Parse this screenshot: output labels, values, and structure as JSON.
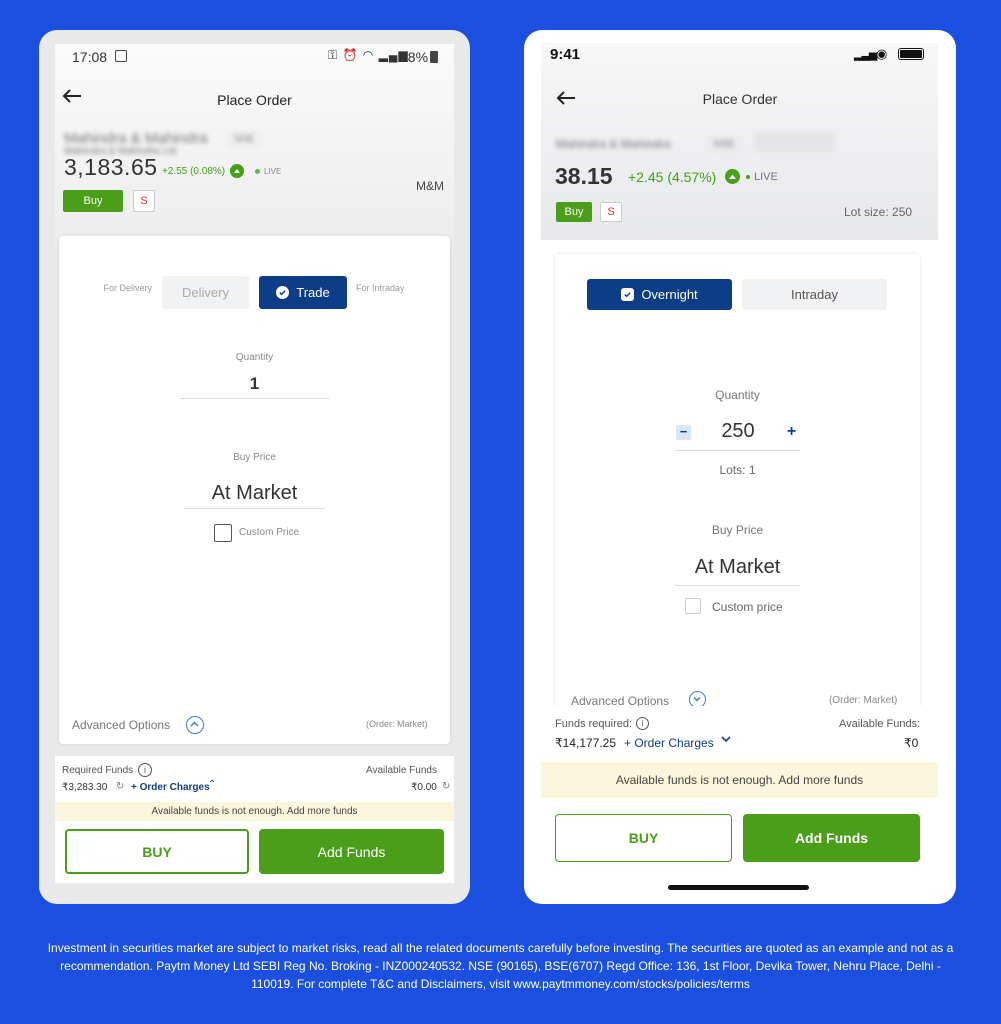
{
  "left": {
    "status_time": "17:08",
    "status_battery": "68%",
    "header_title": "Place Order",
    "stock_name": "Mahindra & Mahindra",
    "stock_subname": "Mahindra & Mahindra Ltd",
    "exchange": "NSE",
    "price": "3,183.65",
    "change": "+2.55 (0.08%)",
    "live_label": "LIVE",
    "symbol": "M&M",
    "buy_small": "Buy",
    "sell_small": "S",
    "delivery_caption": "For Delivery",
    "delivery_label": "Delivery",
    "trade_label": "Trade",
    "intraday_caption": "For Intraday",
    "quantity_label": "Quantity",
    "quantity_value": "1",
    "buy_price_label": "Buy Price",
    "buy_price_value": "At Market",
    "custom_price_label": "Custom Price",
    "advanced_label": "Advanced Options",
    "order_type": "(Order: Market)",
    "required_funds_label": "Required Funds",
    "required_funds_value": "₹3,283.30",
    "order_charges": "+ Order Charges",
    "available_funds_label": "Available Funds",
    "available_funds_value": "₹0.00",
    "warning": "Available funds is not enough. Add more funds",
    "buy_button": "BUY",
    "add_funds_button": "Add Funds"
  },
  "right": {
    "status_time": "9:41",
    "header_title": "Place Order",
    "stock_name": "Mahindra & Mahindra",
    "exchange": "NSE",
    "price": "38.15",
    "change": "+2.45 (4.57%)",
    "live_label": "LIVE",
    "lot_size": "Lot size: 250",
    "buy_small": "Buy",
    "sell_small": "S",
    "overnight_label": "Overnight",
    "intraday_label": "Intraday",
    "quantity_label": "Quantity",
    "quantity_value": "250",
    "minus": "−",
    "plus": "+",
    "lots": "Lots: 1",
    "buy_price_label": "Buy Price",
    "buy_price_value": "At Market",
    "custom_price_label": "Custom price",
    "advanced_label": "Advanced Options",
    "order_type": "(Order: Market)",
    "funds_required_label": "Funds required:",
    "funds_required_value": "₹14,177.25",
    "order_charges": "+ Order Charges",
    "available_funds_label": "Available Funds:",
    "available_funds_value": "₹0",
    "warning": "Available funds is not enough. Add more funds",
    "buy_button": "BUY",
    "add_funds_button": "Add Funds"
  },
  "disclaimer": "Investment in securities market are subject to market risks, read all the related documents carefully before investing. The securities are quoted as an example and not as a recommendation. Paytm Money Ltd SEBI Reg No. Broking - INZ000240532. NSE (90165), BSE(6707) Regd Office: 136, 1st Floor, Devika Tower, Nehru Place, Delhi - 110019. For complete T&C and Disclaimers, visit www.paytmmoney.com/stocks/policies/terms",
  "colors": {
    "background": "#1a4fe0",
    "navy": "#0d3d86",
    "green": "#4a9e19",
    "warning_bg": "#fbf7dc"
  }
}
